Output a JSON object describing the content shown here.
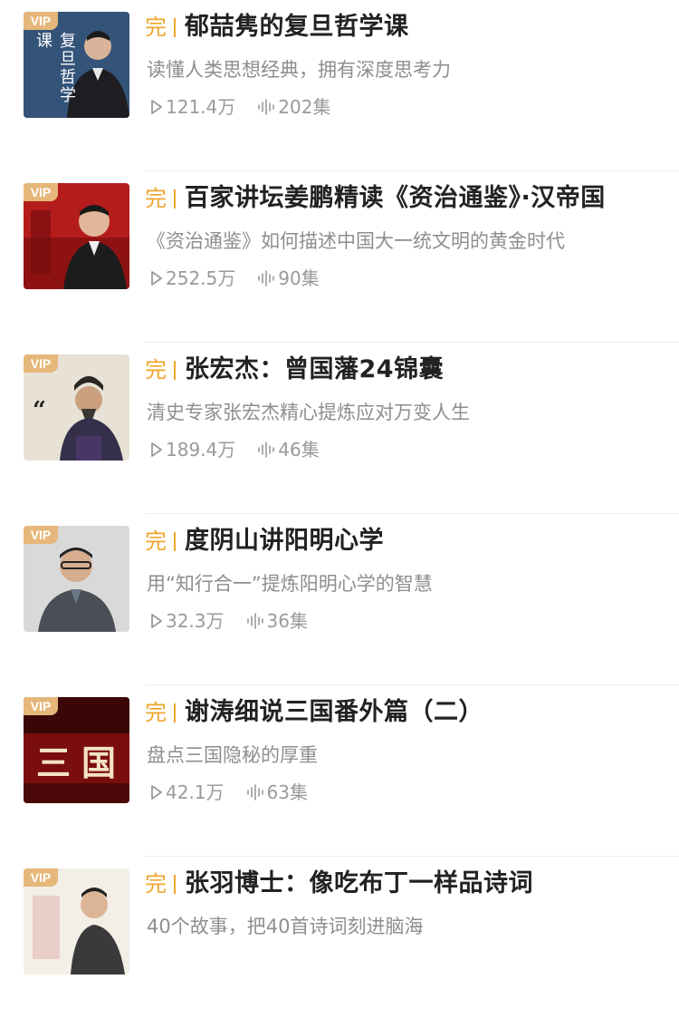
{
  "vip_label": "VIP",
  "complete_label": "完",
  "icons": {
    "plays": "play-icon",
    "episodes": "audio-wave-icon"
  },
  "colors": {
    "vip": "#e6b77a",
    "complete": "#f0a62e",
    "title": "#222222",
    "meta": "#9a9a9a"
  },
  "items": [
    {
      "title": "郁喆隽的复旦哲学课",
      "subtitle": "读懂人类思想经典，拥有深度思考力",
      "plays": "121.4万",
      "episodes": "202集",
      "cover_text": "复旦哲学课"
    },
    {
      "title": "百家讲坛姜鹏精读《资治通鉴》·汉帝国",
      "subtitle": "《资治通鉴》如何描述中国大一统文明的黄金时代",
      "plays": "252.5万",
      "episodes": "90集"
    },
    {
      "title": "张宏杰：曾国藩24锦囊",
      "subtitle": "清史专家张宏杰精心提炼应对万变人生",
      "plays": "189.4万",
      "episodes": "46集"
    },
    {
      "title": "度阴山讲阳明心学",
      "subtitle": "用“知行合一”提炼阳明心学的智慧",
      "plays": "32.3万",
      "episodes": "36集"
    },
    {
      "title": "谢涛细说三国番外篇（二）",
      "subtitle": "盘点三国隐秘的厚重",
      "plays": "42.1万",
      "episodes": "63集",
      "cover_text": "三国"
    },
    {
      "title": "张羽博士：像吃布丁一样品诗词",
      "subtitle": "40个故事，把40首诗词刻进脑海",
      "plays": "",
      "episodes": ""
    }
  ]
}
